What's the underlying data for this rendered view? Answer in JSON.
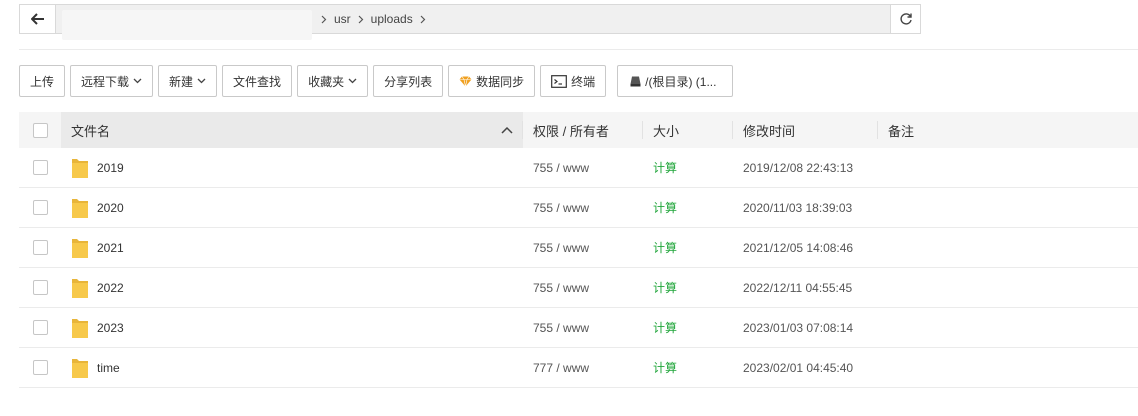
{
  "pathbar": {
    "first_crumb": "/",
    "crumbs": [
      "usr",
      "uploads"
    ]
  },
  "toolbar": {
    "upload": "上传",
    "remote_download": "远程下载",
    "new": "新建",
    "file_search": "文件查找",
    "favorites": "收藏夹",
    "share_list": "分享列表",
    "data_sync": "数据同步",
    "terminal": "终端",
    "disk": "/(根目录) (1..."
  },
  "table": {
    "headers": {
      "name": "文件名",
      "perm": "权限 / 所有者",
      "size": "大小",
      "mtime": "修改时间",
      "note": "备注"
    },
    "rows": [
      {
        "name": "2019",
        "perm": "755 / www",
        "size": "计算",
        "mtime": "2019/12/08 22:43:13",
        "note": ""
      },
      {
        "name": "2020",
        "perm": "755 / www",
        "size": "计算",
        "mtime": "2020/11/03 18:39:03",
        "note": ""
      },
      {
        "name": "2021",
        "perm": "755 / www",
        "size": "计算",
        "mtime": "2021/12/05 14:08:46",
        "note": ""
      },
      {
        "name": "2022",
        "perm": "755 / www",
        "size": "计算",
        "mtime": "2022/12/11 04:55:45",
        "note": ""
      },
      {
        "name": "2023",
        "perm": "755 / www",
        "size": "计算",
        "mtime": "2023/01/03 07:08:14",
        "note": ""
      },
      {
        "name": "time",
        "perm": "777 / www",
        "size": "计算",
        "mtime": "2023/02/01 04:45:40",
        "note": ""
      }
    ]
  },
  "colors": {
    "accent_green": "#20a53a",
    "folder_yellow": "#f7c94b",
    "gem_orange": "#f0a020"
  }
}
